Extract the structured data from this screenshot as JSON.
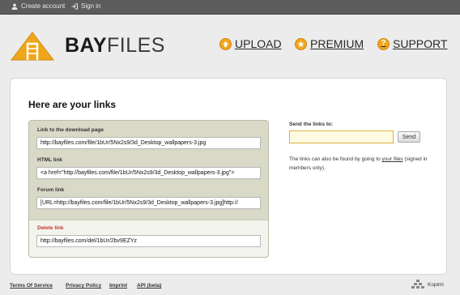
{
  "topbar": {
    "create_account": "Create account",
    "sign_in": "Sign in"
  },
  "header": {
    "logo_bay": "BAY",
    "logo_files": "FILES",
    "nav": [
      {
        "label": "UPLOAD",
        "icon": "upload-icon"
      },
      {
        "label": "PREMIUM",
        "icon": "star-icon"
      },
      {
        "label": "SUPPORT",
        "icon": "question-icon"
      }
    ]
  },
  "main": {
    "title": "Here are your links",
    "fields": [
      {
        "label": "Link to the download page",
        "value": "http://bayfiles.com/file/1bUr/5Nx2s9/3d_Desktop_wallpapers-3.jpg"
      },
      {
        "label": "HTML link",
        "value": "<a href=\"http://bayfiles.com/file/1bUr/5Nx2s9/3d_Desktop_wallpapers-3.jpg\">"
      },
      {
        "label": "Forum link",
        "value": "[URL=http://bayfiles.com/file/1bUr/5Nx2s9/3d_Desktop_wallpapers-3.jpg]http://"
      },
      {
        "label": "Delete link",
        "value": "http://bayfiles.com/del/1bUr/2bv9EZYz"
      }
    ],
    "send": {
      "label": "Send the links to:",
      "value": "",
      "button": "Send"
    },
    "note_before": "The links can also be found by going to ",
    "note_link": "your files",
    "note_after": " (signed in members only)."
  },
  "footer": {
    "links": [
      "Terms Of Service",
      "Privacy Policy",
      "Imprint",
      "API (beta)"
    ],
    "kopimi": "Kopimi"
  },
  "colors": {
    "accent": "#f0a61b",
    "topbar": "#5c5c5c",
    "delete_label": "#c0392b"
  }
}
